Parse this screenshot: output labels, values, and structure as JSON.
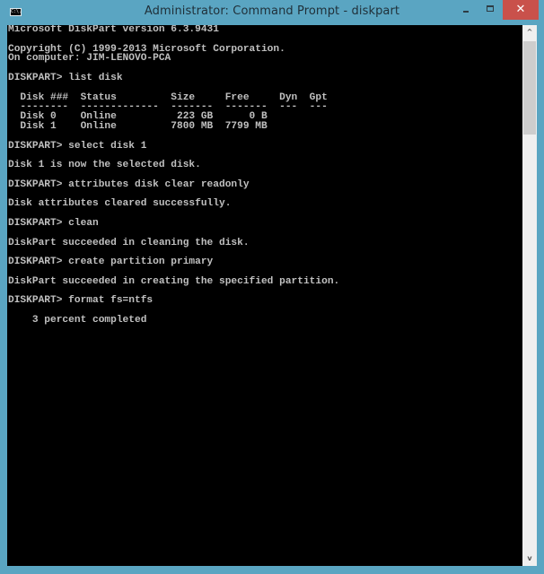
{
  "window": {
    "title": "Administrator: Command Prompt - diskpart",
    "icon": "cmd-icon",
    "icon_text": "C:\\.",
    "controls": {
      "minimize": "minimize-icon",
      "maximize": "maximize-icon",
      "close": "close-icon",
      "minimize_glyph": "",
      "close_glyph": "✕"
    },
    "colors": {
      "frame": "#5aa5c2",
      "close_button": "#c9514b",
      "console_bg": "#000000",
      "console_text": "#c0c0c0"
    }
  },
  "console": {
    "lines": [
      "Microsoft DiskPart version 6.3.9431",
      "",
      "Copyright (C) 1999-2013 Microsoft Corporation.",
      "On computer: JIM-LENOVO-PCA",
      "",
      "DISKPART> list disk",
      "",
      "  Disk ###  Status         Size     Free     Dyn  Gpt",
      "  --------  -------------  -------  -------  ---  ---",
      "  Disk 0    Online          223 GB      0 B",
      "  Disk 1    Online         7800 MB  7799 MB",
      "",
      "DISKPART> select disk 1",
      "",
      "Disk 1 is now the selected disk.",
      "",
      "DISKPART> attributes disk clear readonly",
      "",
      "Disk attributes cleared successfully.",
      "",
      "DISKPART> clean",
      "",
      "DiskPart succeeded in cleaning the disk.",
      "",
      "DISKPART> create partition primary",
      "",
      "DiskPart succeeded in creating the specified partition.",
      "",
      "DISKPART> format fs=ntfs",
      "",
      "    3 percent completed"
    ]
  },
  "scrollbar": {
    "up_glyph": "^",
    "down_glyph": "v"
  }
}
